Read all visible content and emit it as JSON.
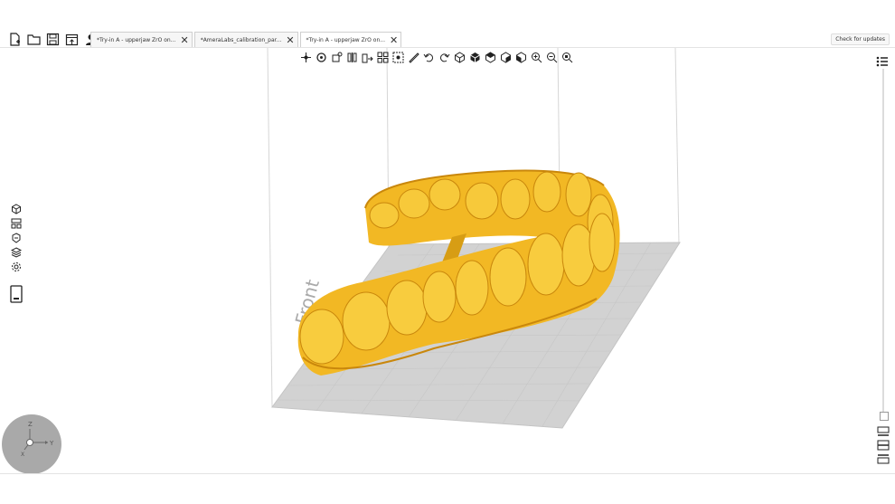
{
  "tabs": [
    {
      "label": "*Try-in A - upperjaw ZrO on...",
      "active": false
    },
    {
      "label": "*AmeraLabs_calibration_par...",
      "active": false
    },
    {
      "label": "*Try-in A - upperjaw ZrO on...",
      "active": true
    }
  ],
  "tab_close_glyph": "✕",
  "check_updates_label": "Check for updates",
  "build_plate_text": "Front",
  "axis_labels": {
    "z": "Z",
    "y": "Y",
    "x": "X"
  },
  "colors": {
    "model": "#f2b824",
    "model_shadow": "#c9870c",
    "plate": "#d2d2d2",
    "axes_gizmo": "#a9a9a9"
  },
  "toolbar_icons": [
    "move-icon",
    "rotate-icon",
    "scale-icon",
    "mirror-icon",
    "layout-icon",
    "arrange-icon",
    "select-icon",
    "measure-icon",
    "undo-icon",
    "redo-icon",
    "view-iso-icon",
    "view-front-icon",
    "view-top-icon",
    "view-side-icon",
    "view-bottom-icon",
    "zoom-in-icon",
    "zoom-out-icon",
    "zoom-fit-icon"
  ],
  "left_icons": [
    "add-model-icon",
    "supports-icon",
    "hollow-icon",
    "layers-icon",
    "settings-icon",
    "printer-icon"
  ],
  "file_icons": [
    "new-file-icon",
    "open-folder-icon",
    "save-icon",
    "export-icon",
    "user-icon"
  ]
}
